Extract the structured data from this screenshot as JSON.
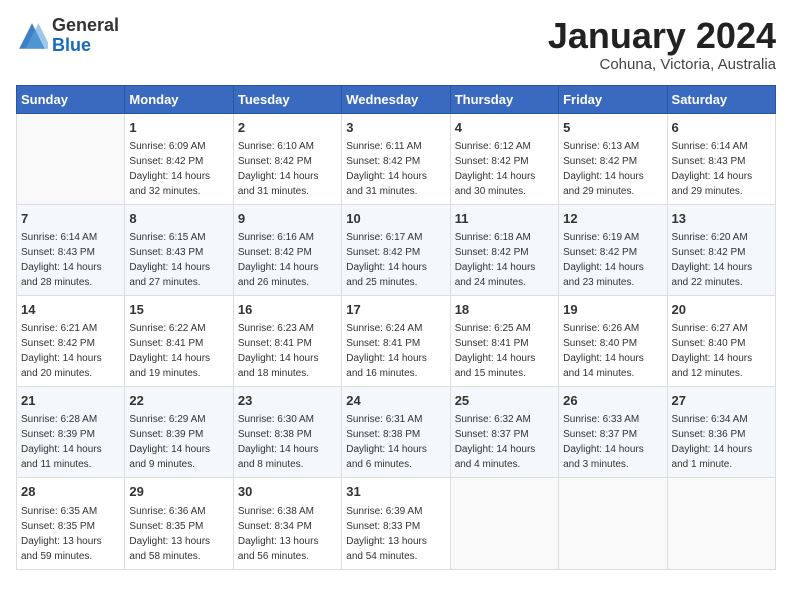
{
  "logo": {
    "general": "General",
    "blue": "Blue"
  },
  "header": {
    "month": "January 2024",
    "location": "Cohuna, Victoria, Australia"
  },
  "weekdays": [
    "Sunday",
    "Monday",
    "Tuesday",
    "Wednesday",
    "Thursday",
    "Friday",
    "Saturday"
  ],
  "weeks": [
    [
      {
        "day": "",
        "sunrise": "",
        "sunset": "",
        "daylight": ""
      },
      {
        "day": "1",
        "sunrise": "Sunrise: 6:09 AM",
        "sunset": "Sunset: 8:42 PM",
        "daylight": "Daylight: 14 hours and 32 minutes."
      },
      {
        "day": "2",
        "sunrise": "Sunrise: 6:10 AM",
        "sunset": "Sunset: 8:42 PM",
        "daylight": "Daylight: 14 hours and 31 minutes."
      },
      {
        "day": "3",
        "sunrise": "Sunrise: 6:11 AM",
        "sunset": "Sunset: 8:42 PM",
        "daylight": "Daylight: 14 hours and 31 minutes."
      },
      {
        "day": "4",
        "sunrise": "Sunrise: 6:12 AM",
        "sunset": "Sunset: 8:42 PM",
        "daylight": "Daylight: 14 hours and 30 minutes."
      },
      {
        "day": "5",
        "sunrise": "Sunrise: 6:13 AM",
        "sunset": "Sunset: 8:42 PM",
        "daylight": "Daylight: 14 hours and 29 minutes."
      },
      {
        "day": "6",
        "sunrise": "Sunrise: 6:14 AM",
        "sunset": "Sunset: 8:43 PM",
        "daylight": "Daylight: 14 hours and 29 minutes."
      }
    ],
    [
      {
        "day": "7",
        "sunrise": "Sunrise: 6:14 AM",
        "sunset": "Sunset: 8:43 PM",
        "daylight": "Daylight: 14 hours and 28 minutes."
      },
      {
        "day": "8",
        "sunrise": "Sunrise: 6:15 AM",
        "sunset": "Sunset: 8:43 PM",
        "daylight": "Daylight: 14 hours and 27 minutes."
      },
      {
        "day": "9",
        "sunrise": "Sunrise: 6:16 AM",
        "sunset": "Sunset: 8:42 PM",
        "daylight": "Daylight: 14 hours and 26 minutes."
      },
      {
        "day": "10",
        "sunrise": "Sunrise: 6:17 AM",
        "sunset": "Sunset: 8:42 PM",
        "daylight": "Daylight: 14 hours and 25 minutes."
      },
      {
        "day": "11",
        "sunrise": "Sunrise: 6:18 AM",
        "sunset": "Sunset: 8:42 PM",
        "daylight": "Daylight: 14 hours and 24 minutes."
      },
      {
        "day": "12",
        "sunrise": "Sunrise: 6:19 AM",
        "sunset": "Sunset: 8:42 PM",
        "daylight": "Daylight: 14 hours and 23 minutes."
      },
      {
        "day": "13",
        "sunrise": "Sunrise: 6:20 AM",
        "sunset": "Sunset: 8:42 PM",
        "daylight": "Daylight: 14 hours and 22 minutes."
      }
    ],
    [
      {
        "day": "14",
        "sunrise": "Sunrise: 6:21 AM",
        "sunset": "Sunset: 8:42 PM",
        "daylight": "Daylight: 14 hours and 20 minutes."
      },
      {
        "day": "15",
        "sunrise": "Sunrise: 6:22 AM",
        "sunset": "Sunset: 8:41 PM",
        "daylight": "Daylight: 14 hours and 19 minutes."
      },
      {
        "day": "16",
        "sunrise": "Sunrise: 6:23 AM",
        "sunset": "Sunset: 8:41 PM",
        "daylight": "Daylight: 14 hours and 18 minutes."
      },
      {
        "day": "17",
        "sunrise": "Sunrise: 6:24 AM",
        "sunset": "Sunset: 8:41 PM",
        "daylight": "Daylight: 14 hours and 16 minutes."
      },
      {
        "day": "18",
        "sunrise": "Sunrise: 6:25 AM",
        "sunset": "Sunset: 8:41 PM",
        "daylight": "Daylight: 14 hours and 15 minutes."
      },
      {
        "day": "19",
        "sunrise": "Sunrise: 6:26 AM",
        "sunset": "Sunset: 8:40 PM",
        "daylight": "Daylight: 14 hours and 14 minutes."
      },
      {
        "day": "20",
        "sunrise": "Sunrise: 6:27 AM",
        "sunset": "Sunset: 8:40 PM",
        "daylight": "Daylight: 14 hours and 12 minutes."
      }
    ],
    [
      {
        "day": "21",
        "sunrise": "Sunrise: 6:28 AM",
        "sunset": "Sunset: 8:39 PM",
        "daylight": "Daylight: 14 hours and 11 minutes."
      },
      {
        "day": "22",
        "sunrise": "Sunrise: 6:29 AM",
        "sunset": "Sunset: 8:39 PM",
        "daylight": "Daylight: 14 hours and 9 minutes."
      },
      {
        "day": "23",
        "sunrise": "Sunrise: 6:30 AM",
        "sunset": "Sunset: 8:38 PM",
        "daylight": "Daylight: 14 hours and 8 minutes."
      },
      {
        "day": "24",
        "sunrise": "Sunrise: 6:31 AM",
        "sunset": "Sunset: 8:38 PM",
        "daylight": "Daylight: 14 hours and 6 minutes."
      },
      {
        "day": "25",
        "sunrise": "Sunrise: 6:32 AM",
        "sunset": "Sunset: 8:37 PM",
        "daylight": "Daylight: 14 hours and 4 minutes."
      },
      {
        "day": "26",
        "sunrise": "Sunrise: 6:33 AM",
        "sunset": "Sunset: 8:37 PM",
        "daylight": "Daylight: 14 hours and 3 minutes."
      },
      {
        "day": "27",
        "sunrise": "Sunrise: 6:34 AM",
        "sunset": "Sunset: 8:36 PM",
        "daylight": "Daylight: 14 hours and 1 minute."
      }
    ],
    [
      {
        "day": "28",
        "sunrise": "Sunrise: 6:35 AM",
        "sunset": "Sunset: 8:35 PM",
        "daylight": "Daylight: 13 hours and 59 minutes."
      },
      {
        "day": "29",
        "sunrise": "Sunrise: 6:36 AM",
        "sunset": "Sunset: 8:35 PM",
        "daylight": "Daylight: 13 hours and 58 minutes."
      },
      {
        "day": "30",
        "sunrise": "Sunrise: 6:38 AM",
        "sunset": "Sunset: 8:34 PM",
        "daylight": "Daylight: 13 hours and 56 minutes."
      },
      {
        "day": "31",
        "sunrise": "Sunrise: 6:39 AM",
        "sunset": "Sunset: 8:33 PM",
        "daylight": "Daylight: 13 hours and 54 minutes."
      },
      {
        "day": "",
        "sunrise": "",
        "sunset": "",
        "daylight": ""
      },
      {
        "day": "",
        "sunrise": "",
        "sunset": "",
        "daylight": ""
      },
      {
        "day": "",
        "sunrise": "",
        "sunset": "",
        "daylight": ""
      }
    ]
  ]
}
